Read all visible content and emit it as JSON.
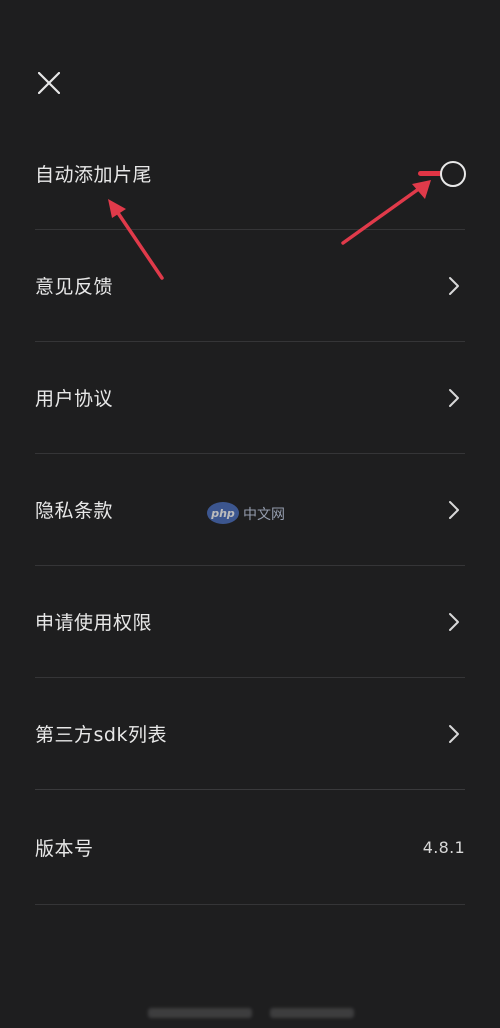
{
  "close_icon": "close-icon",
  "settings": {
    "items": [
      {
        "label": "自动添加片尾",
        "type": "toggle",
        "enabled": true
      },
      {
        "label": "意见反馈",
        "type": "link"
      },
      {
        "label": "用户协议",
        "type": "link"
      },
      {
        "label": "隐私条款",
        "type": "link"
      },
      {
        "label": "申请使用权限",
        "type": "link"
      },
      {
        "label": "第三方sdk列表",
        "type": "link"
      }
    ],
    "version": {
      "label": "版本号",
      "value": "4.8.1"
    }
  },
  "colors": {
    "background": "#1e1e1f",
    "accent": "#e03545",
    "annotation_arrow": "#e03a4a"
  },
  "watermark": {
    "logo_text": "php",
    "site_text": "中文网"
  }
}
